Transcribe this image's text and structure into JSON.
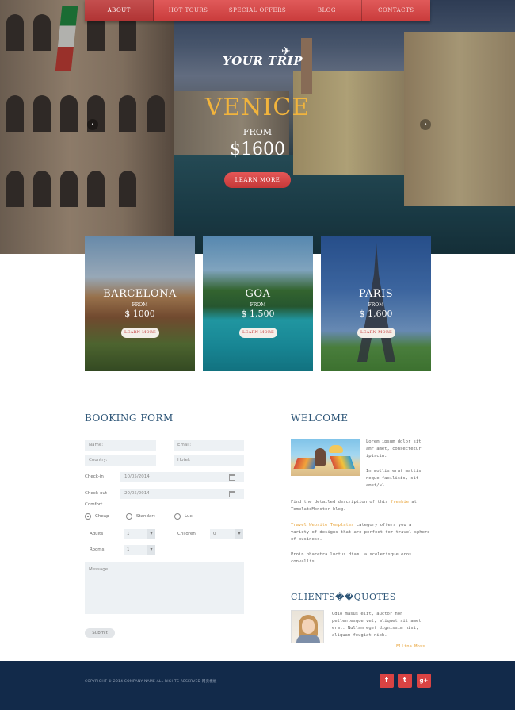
{
  "nav": {
    "items": [
      {
        "label": "ABOUT"
      },
      {
        "label": "HOT TOURS"
      },
      {
        "label": "SPECIAL OFFERS"
      },
      {
        "label": "BLOG"
      },
      {
        "label": "CONTACTS"
      }
    ],
    "active_index": 0
  },
  "hero": {
    "logo": "YOUR TRIP",
    "title": "VENICE",
    "from_label": "FROM",
    "price": "$1600",
    "button": "LEARN MORE"
  },
  "cards": [
    {
      "title": "BARCELONA",
      "from_label": "FROM",
      "price": "$ 1000",
      "button": "LEARN MORE"
    },
    {
      "title": "GOA",
      "from_label": "FROM",
      "price": "$ 1,500",
      "button": "LEARN MORE"
    },
    {
      "title": "PARIS",
      "from_label": "FROM",
      "price": "$ 1,600",
      "button": "LEARN MORE"
    }
  ],
  "booking": {
    "title": "BOOKING FORM",
    "name_placeholder": "Name:",
    "email_placeholder": "Email:",
    "country_placeholder": "Country:",
    "hotel_placeholder": "Hotel:",
    "checkin_label": "Check-in",
    "checkin_value": "10/05/2014",
    "checkout_label": "Check-out",
    "checkout_value": "20/05/2014",
    "comfort_label": "Comfort",
    "comfort_options": [
      "Cheap",
      "Standart",
      "Lux"
    ],
    "comfort_selected": 0,
    "adults_label": "Adults",
    "adults_value": "1",
    "children_label": "Children",
    "children_value": "0",
    "rooms_label": "Rooms",
    "rooms_value": "1",
    "message_placeholder": "Message",
    "submit": "Submit"
  },
  "welcome": {
    "title": "WELCOME",
    "side_text_1": "Lorem ipsum dolor sit amr amet, consectetur ipiscin.",
    "side_text_2": "In mollis erat mattis neque facilisis, sit amet/ul",
    "para1_a": "Find the detailed description of this ",
    "para1_link": "freebie",
    "para1_b": " at TemplateMonster blog.",
    "para2_link": "Travel Website Templates",
    "para2_b": " category offers you a variety of designs that are perfect for travel sphere of business.",
    "para3": "Proin pharetra luctus diam, a scelerisque eros convallis"
  },
  "clients": {
    "title": "CLIENTS��QUOTES",
    "quote": "Odio masus elit, auctor non pellentesque vel, aliquet sit amet erat. Nullam eget dignissim nisi, aliquam feugiat nibh.",
    "name": "Ellina Moss"
  },
  "footer": {
    "copyright": "COPYRIGHT © 2014 COMPANY NAME ALL RIGHTS RESERVED 网页模板",
    "social": [
      {
        "icon": "facebook-icon",
        "glyph": "f"
      },
      {
        "icon": "twitter-icon",
        "glyph": "t"
      },
      {
        "icon": "google-plus-icon",
        "glyph": "g+"
      }
    ]
  },
  "colors": {
    "accent_red": "#d94343",
    "title_gold": "#f2b43c",
    "footer_navy": "#122a4a",
    "heading_blue": "#2d5577"
  }
}
